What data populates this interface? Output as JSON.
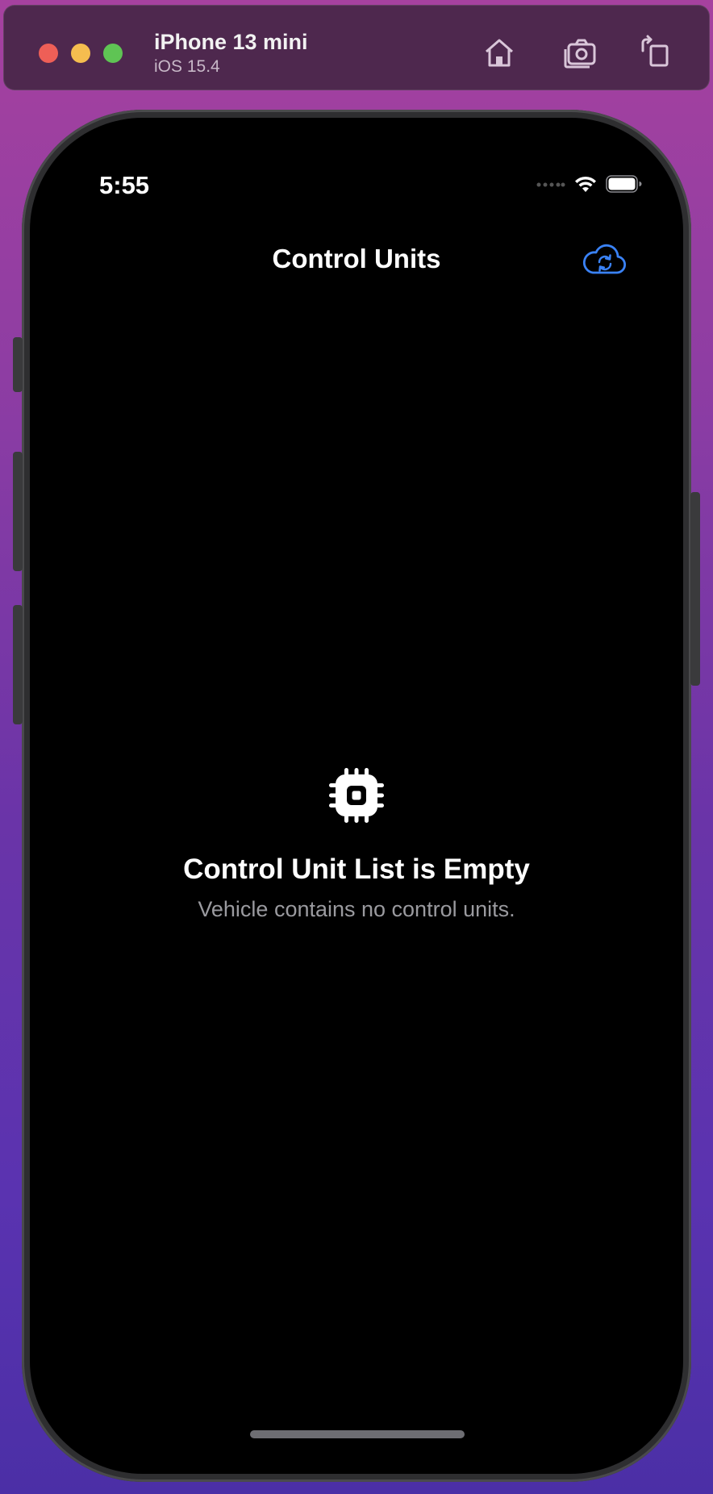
{
  "simulator": {
    "device_name": "iPhone 13 mini",
    "os_version": "iOS 15.4",
    "icons": [
      "home-icon",
      "screenshot-icon",
      "rotate-icon"
    ]
  },
  "status_bar": {
    "time": "5:55",
    "icons": [
      "signal-icon",
      "wifi-icon",
      "battery-icon"
    ]
  },
  "nav": {
    "title": "Control Units",
    "action_icon": "cloud-sync-icon",
    "accent_color": "#3a82f6"
  },
  "empty_state": {
    "icon": "cpu-chip-icon",
    "title": "Control Unit List is Empty",
    "subtitle": "Vehicle contains no control units."
  },
  "colors": {
    "screen_background": "#000000",
    "subtitle_text": "#9a9a9f"
  }
}
